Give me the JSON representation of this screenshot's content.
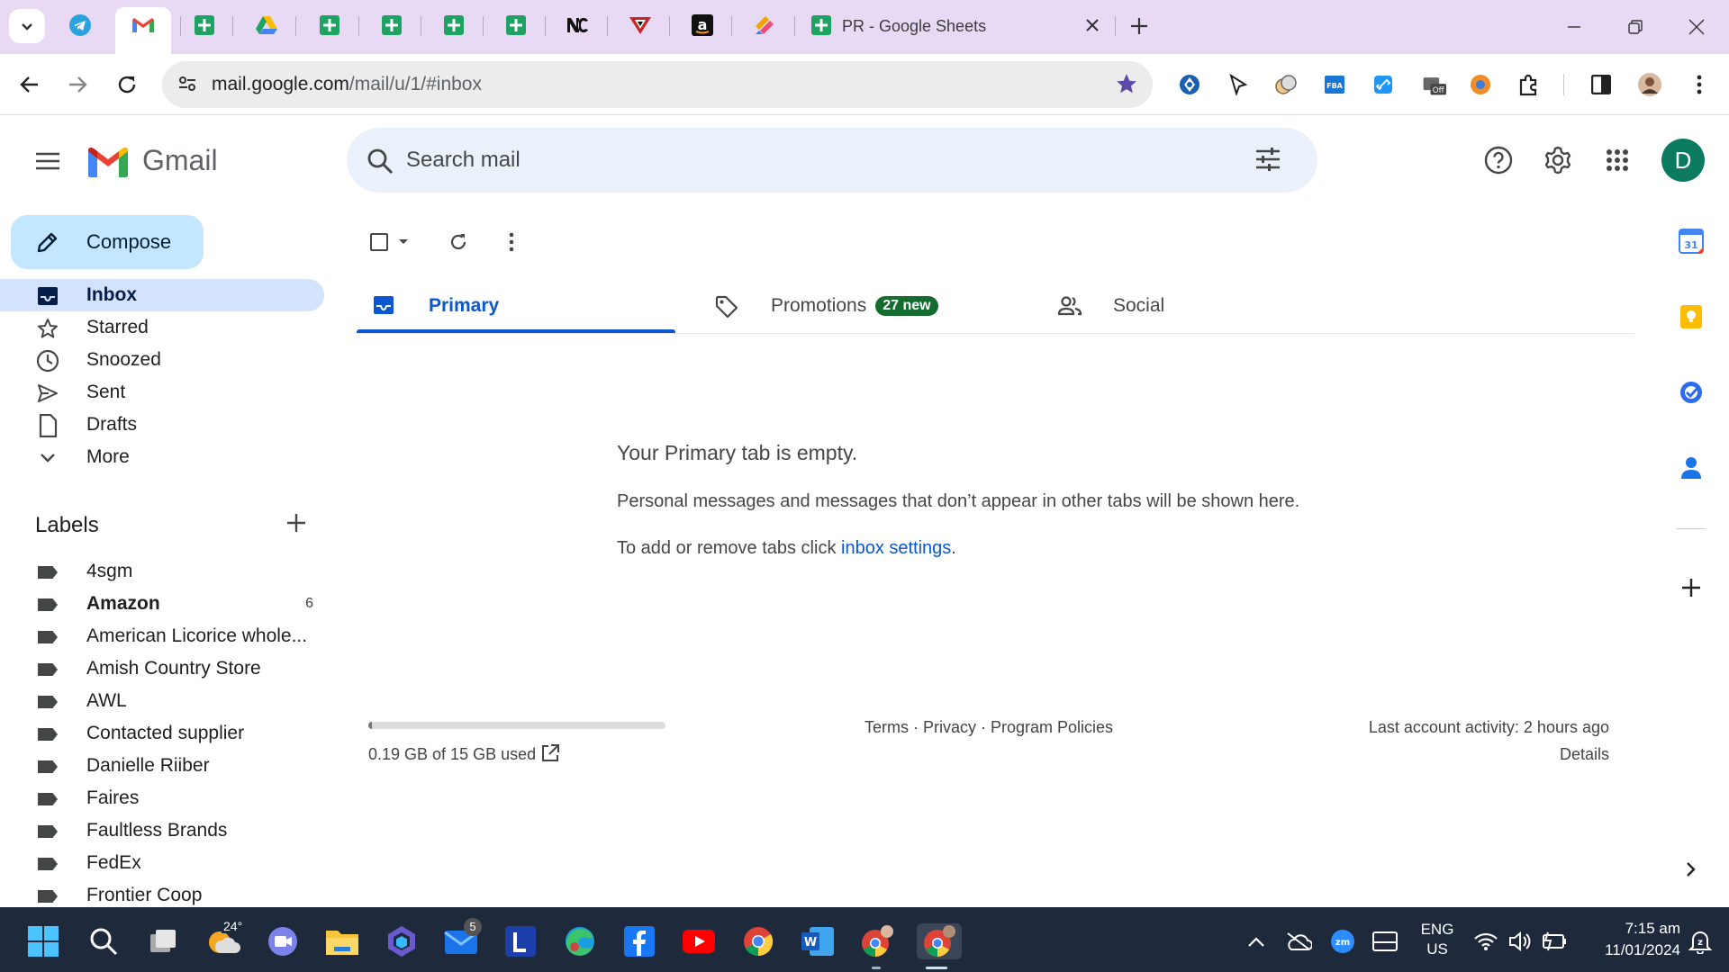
{
  "browser": {
    "active_tab_title": "PR - Google Sheets",
    "url_host": "mail.google.com",
    "url_path": "/mail/u/1/#inbox"
  },
  "gmail": {
    "logo_text": "Gmail",
    "search_placeholder": "Search mail",
    "avatar_letter": "D",
    "compose_label": "Compose",
    "nav": [
      {
        "label": "Inbox",
        "icon": "inbox-icon",
        "selected": true
      },
      {
        "label": "Starred",
        "icon": "star-icon"
      },
      {
        "label": "Snoozed",
        "icon": "clock-icon"
      },
      {
        "label": "Sent",
        "icon": "send-icon"
      },
      {
        "label": "Drafts",
        "icon": "draft-icon"
      },
      {
        "label": "More",
        "icon": "chevron-down-icon"
      }
    ],
    "labels_heading": "Labels",
    "labels": [
      {
        "name": "4sgm",
        "count": ""
      },
      {
        "name": "Amazon",
        "count": "6",
        "bold": true
      },
      {
        "name": "American Licorice whole...",
        "count": ""
      },
      {
        "name": "Amish Country Store",
        "count": ""
      },
      {
        "name": "AWL",
        "count": ""
      },
      {
        "name": "Contacted supplier",
        "count": ""
      },
      {
        "name": "Danielle Riiber",
        "count": ""
      },
      {
        "name": "Faires",
        "count": ""
      },
      {
        "name": "Faultless Brands",
        "count": ""
      },
      {
        "name": "FedEx",
        "count": ""
      },
      {
        "name": "Frontier Coop",
        "count": ""
      }
    ],
    "tabs": {
      "primary": "Primary",
      "promotions": "Promotions",
      "promotions_badge": "27 new",
      "social": "Social"
    },
    "empty": {
      "title": "Your Primary tab is empty.",
      "line1": "Personal messages and messages that don’t appear in other tabs will be shown here.",
      "line2_prefix": "To add or remove tabs click ",
      "line2_link": "inbox settings",
      "line2_suffix": "."
    },
    "footer": {
      "storage_used": "0.19 GB of 15 GB used",
      "storage_fraction": 0.013,
      "links": "Terms · Privacy · Program Policies",
      "last_activity": "Last account activity: 2 hours ago",
      "details": "Details"
    }
  },
  "taskbar": {
    "weather_temp": "24°",
    "mail_badge": "5",
    "lang_line1": "ENG",
    "lang_line2": "US",
    "time": "7:15 am",
    "date": "11/01/2024"
  },
  "colors": {
    "tabstrip": "#e8d9f5",
    "accent_blue": "#0b57d0",
    "compose_bg": "#c2e7ff",
    "nav_selected_bg": "#d3e3fd",
    "promotions_badge": "#146c2e",
    "avatar_bg": "#0b7a5f",
    "taskbar_bg": "#1e2a3b"
  }
}
